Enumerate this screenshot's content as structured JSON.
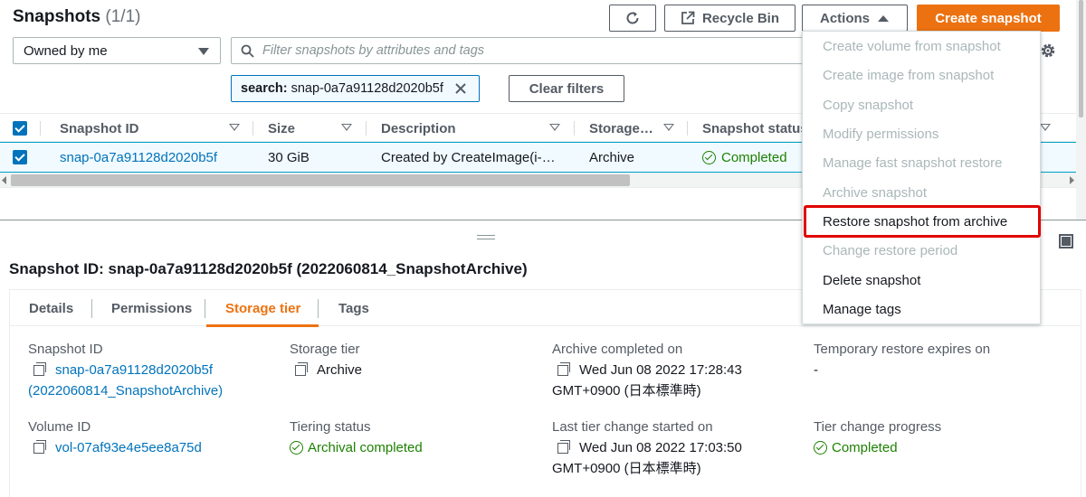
{
  "header": {
    "title": "Snapshots",
    "count": "(1/1)",
    "recycle_bin_label": "Recycle Bin",
    "actions_label": "Actions",
    "create_label": "Create snapshot"
  },
  "filters": {
    "owner_select": "Owned by me",
    "search_placeholder": "Filter snapshots by attributes and tags",
    "token_key": "search:",
    "token_value": "snap-0a7a91128d2020b5f",
    "clear_label": "Clear filters"
  },
  "table": {
    "columns": [
      "Snapshot ID",
      "Size",
      "Description",
      "Storage…",
      "Snapshot status"
    ],
    "row": {
      "snapshot_id": "snap-0a7a91128d2020b5f",
      "size": "30 GiB",
      "description": "Created by CreateImage(i-…",
      "storage": "Archive",
      "status": "Completed"
    }
  },
  "actions_menu": {
    "items": [
      {
        "label": "Create volume from snapshot",
        "enabled": false
      },
      {
        "label": "Create image from snapshot",
        "enabled": false
      },
      {
        "label": "Copy snapshot",
        "enabled": false
      },
      {
        "label": "Modify permissions",
        "enabled": false
      },
      {
        "label": "Manage fast snapshot restore",
        "enabled": false
      },
      {
        "label": "Archive snapshot",
        "enabled": false
      },
      {
        "label": "Restore snapshot from archive",
        "enabled": true,
        "highlighted": true
      },
      {
        "label": "Change restore period",
        "enabled": false
      },
      {
        "label": "Delete snapshot",
        "enabled": true
      },
      {
        "label": "Manage tags",
        "enabled": true
      }
    ]
  },
  "detail": {
    "title": "Snapshot ID: snap-0a7a91128d2020b5f (2022060814_SnapshotArchive)",
    "tabs": [
      "Details",
      "Permissions",
      "Storage tier",
      "Tags"
    ],
    "active_tab": "Storage tier",
    "fields": {
      "snapshot_id_label": "Snapshot ID",
      "snapshot_id_value_1": "snap-0a7a91128d2020b5f",
      "snapshot_id_value_2": "(2022060814_SnapshotArchive)",
      "volume_id_label": "Volume ID",
      "volume_id_value": "vol-07af93e4e5ee8a75d",
      "storage_tier_label": "Storage tier",
      "storage_tier_value": "Archive",
      "tiering_status_label": "Tiering status",
      "tiering_status_value": "Archival completed",
      "archive_completed_label": "Archive completed on",
      "archive_completed_value_1": "Wed Jun 08 2022 17:28:43",
      "archive_completed_value_2": "GMT+0900 (日本標準時)",
      "last_tier_change_label": "Last tier change started on",
      "last_tier_change_value_1": "Wed Jun 08 2022 17:03:50",
      "last_tier_change_value_2": "GMT+0900 (日本標準時)",
      "temp_restore_label": "Temporary restore expires on",
      "temp_restore_value": "-",
      "tier_change_progress_label": "Tier change progress",
      "tier_change_progress_value": "Completed"
    }
  },
  "colors": {
    "primary": "#ec7211",
    "link": "#0073bb",
    "success": "#1d8102",
    "highlight": "#e00000"
  }
}
